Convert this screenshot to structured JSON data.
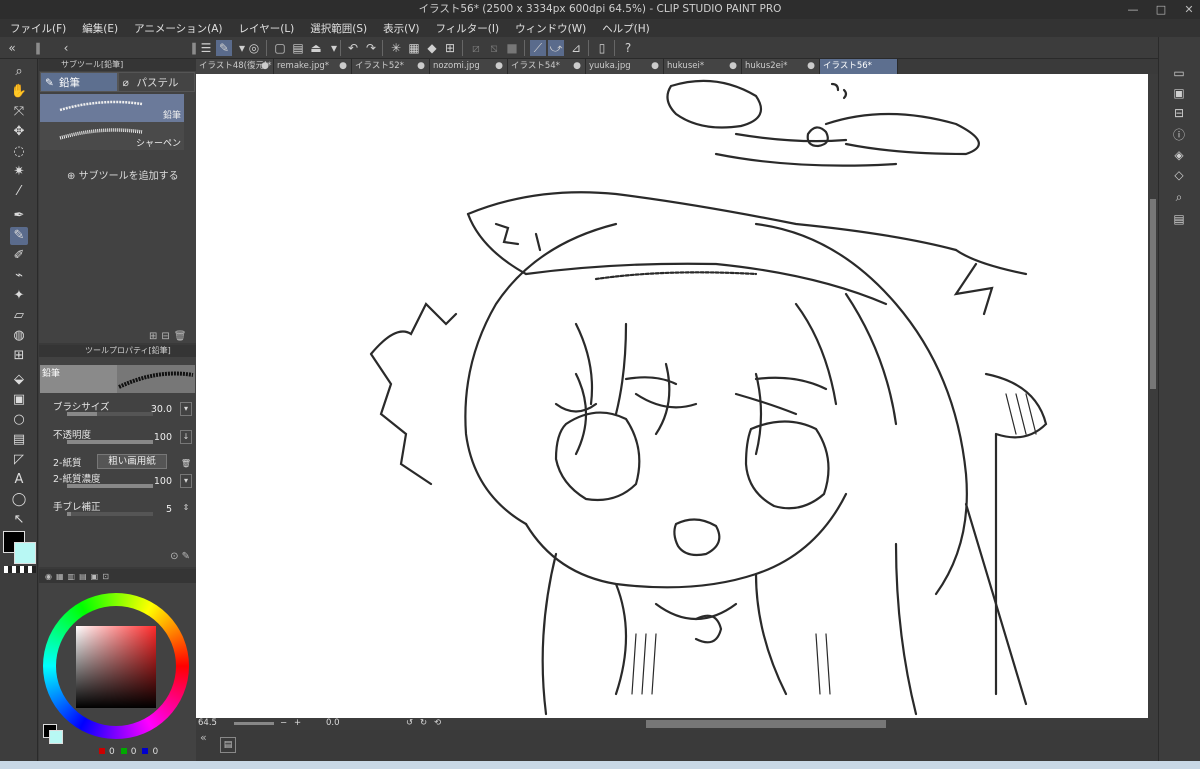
{
  "window": {
    "title": "イラスト56* (2500 x 3334px 600dpi 64.5%)  - CLIP STUDIO PAINT PRO",
    "controls": [
      "—",
      "□",
      "✕"
    ]
  },
  "menu": [
    "ファイル(F)",
    "編集(E)",
    "アニメーション(A)",
    "レイヤー(L)",
    "選択範囲(S)",
    "表示(V)",
    "フィルター(I)",
    "ウィンドウ(W)",
    "ヘルプ(H)"
  ],
  "subtool_panel": {
    "header": "サブツール[鉛筆]",
    "tabs": [
      {
        "label": "鉛筆",
        "icon": "pencil-icon",
        "selected": true
      },
      {
        "label": "パステル",
        "icon": "pastel-icon",
        "selected": false
      }
    ],
    "brushes": [
      {
        "label": "鉛筆",
        "selected": true
      },
      {
        "label": "シャーペン",
        "selected": false
      }
    ],
    "add_label": "サブツールを追加する"
  },
  "tool_property": {
    "header": "ツールプロパティ[鉛筆]",
    "preset_name": "鉛筆",
    "props": [
      {
        "label": "ブラシサイズ",
        "value": "30.0",
        "fill": 0.35
      },
      {
        "label": "不透明度",
        "value": "100",
        "fill": 1.0
      },
      {
        "label": "2-紙質",
        "value": "粗い画用紙"
      },
      {
        "label": "2-紙質濃度",
        "value": "100",
        "fill": 1.0
      },
      {
        "label": "手ブレ補正",
        "value": "5",
        "fill": 0.05
      }
    ]
  },
  "color_panel": {
    "fg": "#000000",
    "bg": "#b8f8f4",
    "rgb": [
      "0",
      "0",
      "0"
    ]
  },
  "doc_tabs": [
    {
      "label": "イラスト48(復元)*",
      "selected": false
    },
    {
      "label": "remake.jpg*",
      "selected": false
    },
    {
      "label": "イラスト52*",
      "selected": false
    },
    {
      "label": "nozomi.jpg",
      "selected": false
    },
    {
      "label": "イラスト54*",
      "selected": false
    },
    {
      "label": "yuuka.jpg",
      "selected": false
    },
    {
      "label": "hukusei*",
      "selected": false
    },
    {
      "label": "hukus2ei*",
      "selected": false
    },
    {
      "label": "イラスト56*",
      "selected": true
    }
  ],
  "navigator": {
    "zoom": "64.5",
    "rotation": "0.0"
  },
  "accent": "#5d6f8f"
}
